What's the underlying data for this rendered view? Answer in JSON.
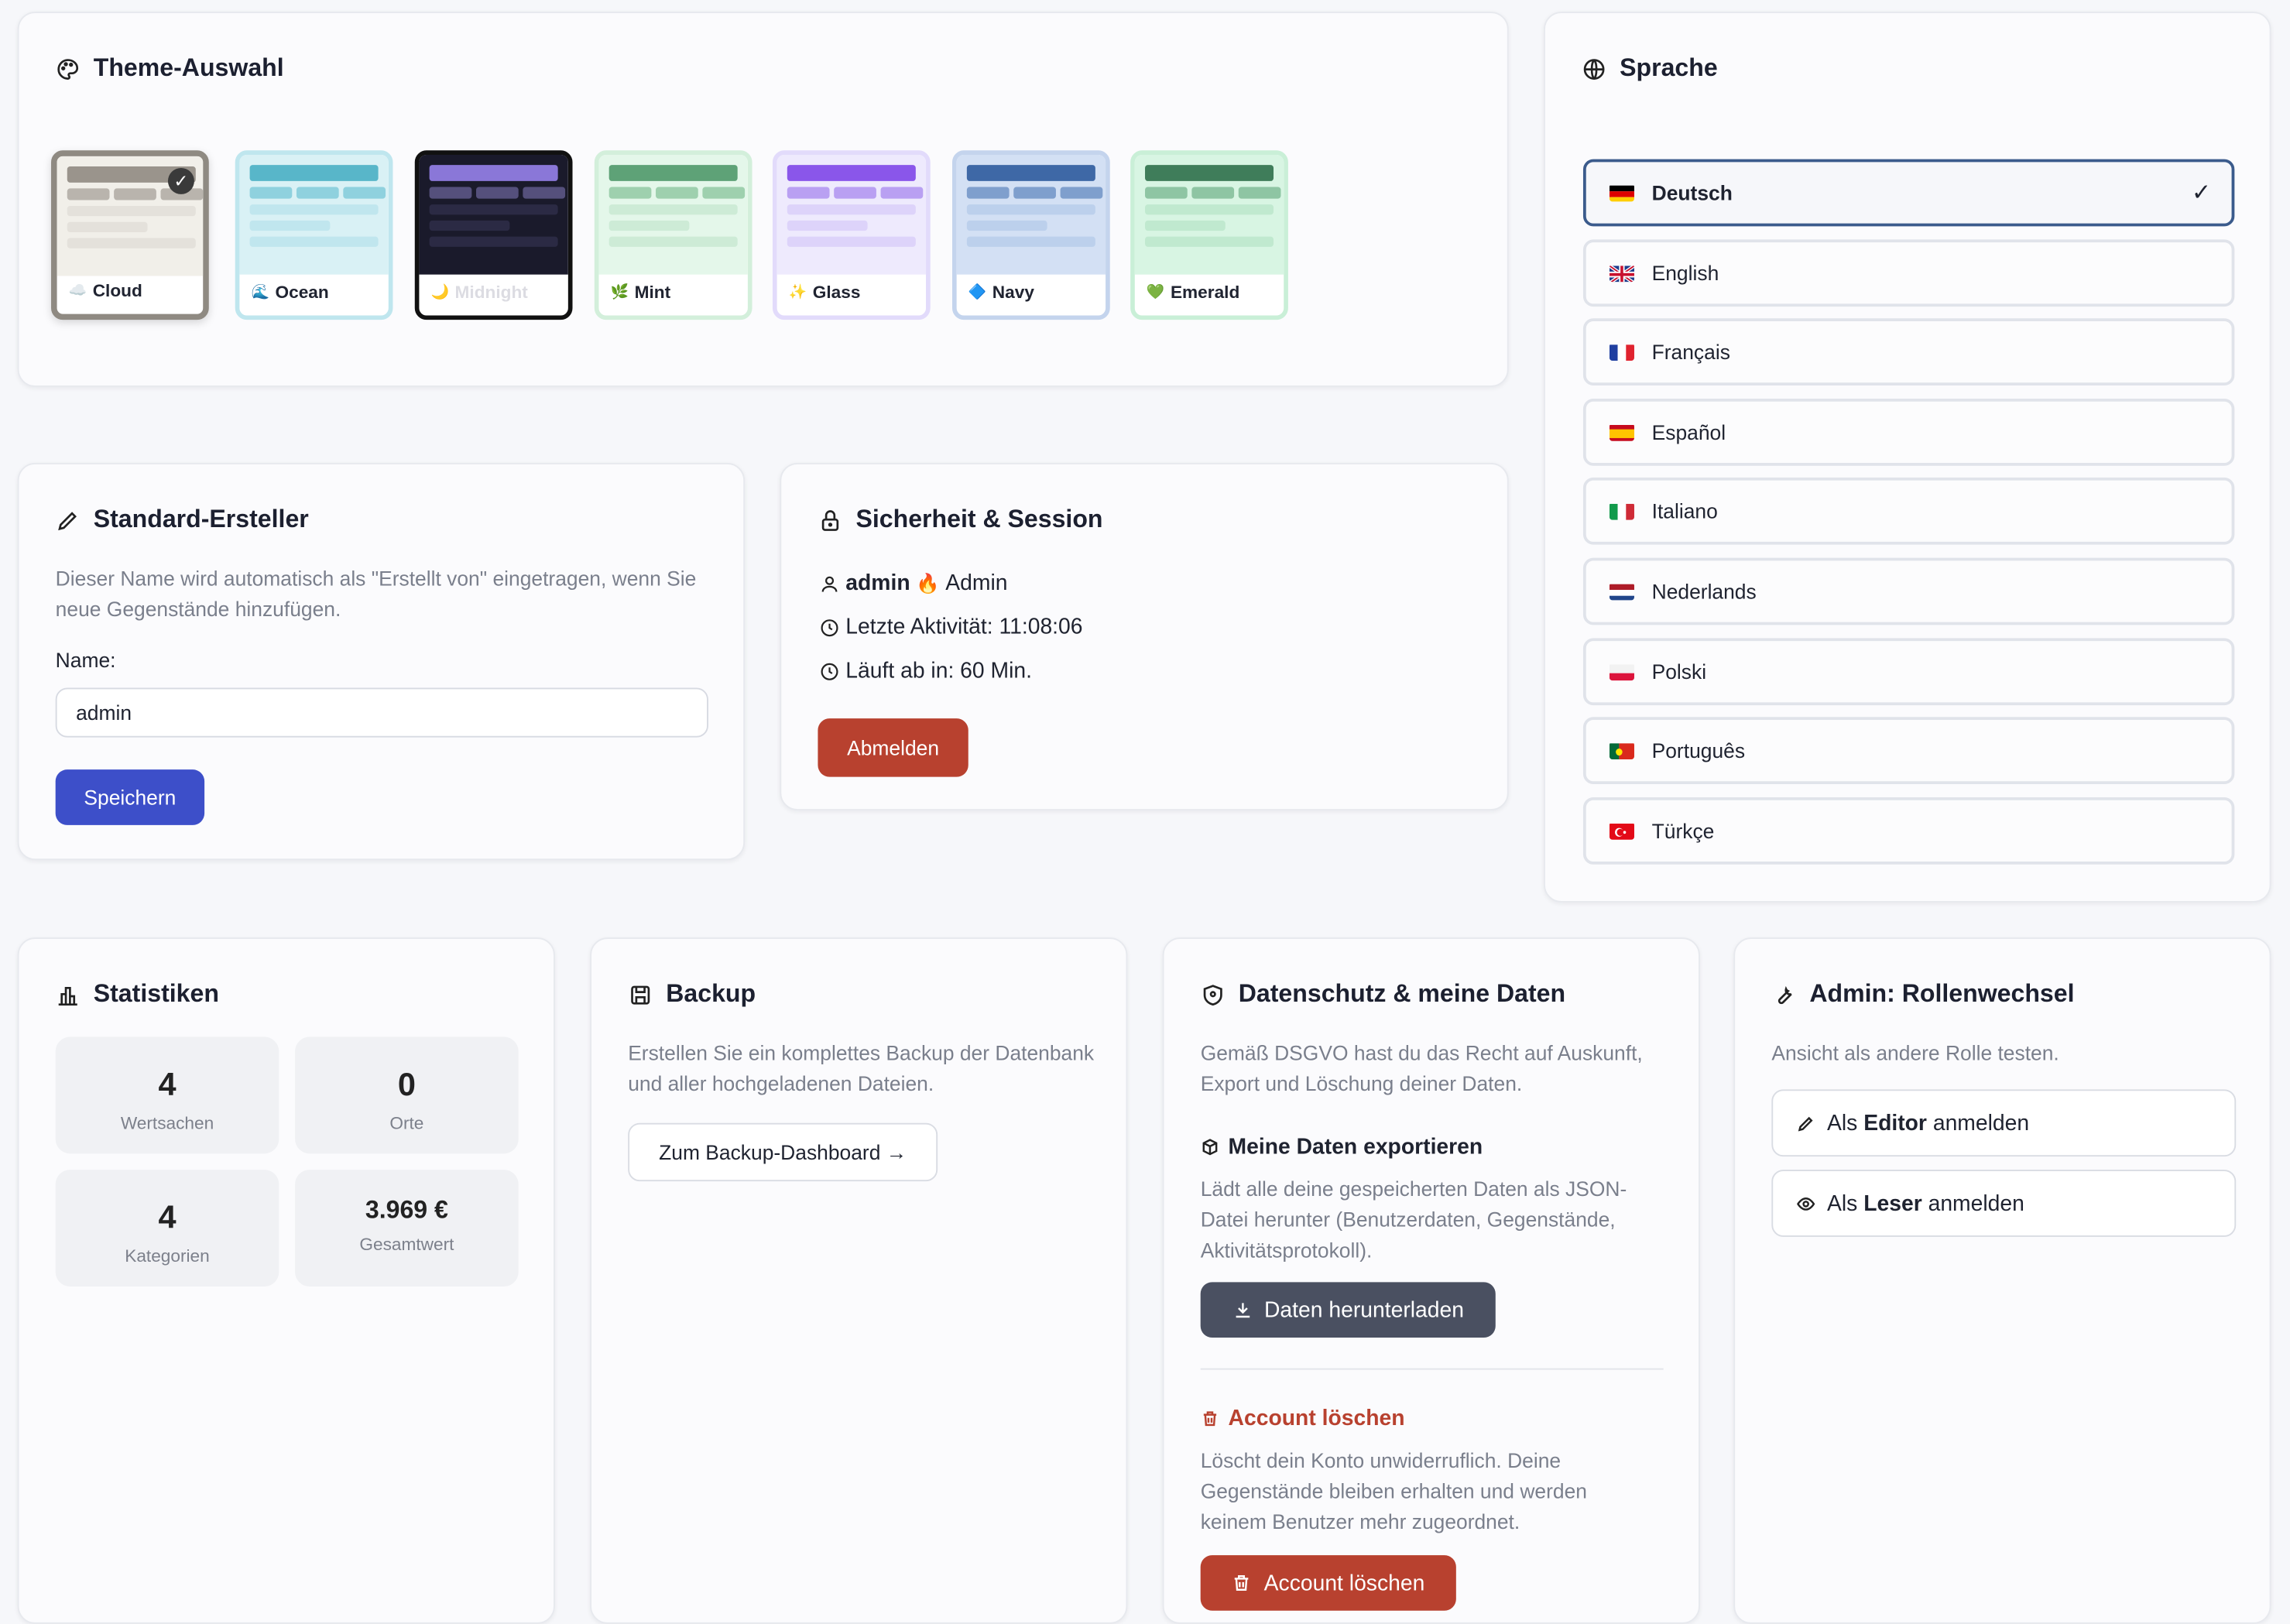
{
  "theme": {
    "title": "Theme-Auswahl",
    "options": [
      {
        "label": "Cloud",
        "emoji": "☁️",
        "selected": true,
        "colors": {
          "bg": "#f1efe9",
          "bar1": "#9a948c",
          "bar2": "#b9b4ad",
          "line": "#e4e1db",
          "border": "#8f8a82",
          "text": "#202431"
        }
      },
      {
        "label": "Ocean",
        "emoji": "🌊",
        "selected": false,
        "colors": {
          "bg": "#d9f1f5",
          "bar1": "#58b6c9",
          "bar2": "#8fd1de",
          "line": "#c0e6ee",
          "border": "#bfe6ee",
          "text": "#202431"
        }
      },
      {
        "label": "Midnight",
        "emoji": "🌙",
        "selected": false,
        "colors": {
          "bg": "#1a1a2b",
          "bar1": "#8a77d8",
          "bar2": "#55507c",
          "line": "#2b2a44",
          "border": "#111",
          "text": "#dcdce2"
        }
      },
      {
        "label": "Mint",
        "emoji": "🌿",
        "selected": false,
        "colors": {
          "bg": "#e4f7ea",
          "bar1": "#5ea277",
          "bar2": "#9ed0ae",
          "line": "#cdebd6",
          "border": "#d3efdb",
          "text": "#202431"
        }
      },
      {
        "label": "Glass",
        "emoji": "✨",
        "selected": false,
        "colors": {
          "bg": "#eeeafd",
          "bar1": "#8a56ea",
          "bar2": "#b9a0f2",
          "line": "#ddd3fa",
          "border": "#e2dbfb",
          "text": "#202431"
        }
      },
      {
        "label": "Navy",
        "emoji": "🔷",
        "selected": false,
        "colors": {
          "bg": "#d3e0f4",
          "bar1": "#3e68a6",
          "bar2": "#7f9fcd",
          "line": "#bcd0ec",
          "border": "#c4d4ed",
          "text": "#202431"
        }
      },
      {
        "label": "Emerald",
        "emoji": "💚",
        "selected": false,
        "colors": {
          "bg": "#d8f5e3",
          "bar1": "#3f7d5a",
          "bar2": "#8ec5a3",
          "line": "#c0e9cf",
          "border": "#c9efd7",
          "text": "#202431"
        }
      }
    ]
  },
  "language": {
    "title": "Sprache",
    "options": [
      {
        "label": "Deutsch",
        "flag": "de",
        "selected": true
      },
      {
        "label": "English",
        "flag": "gb",
        "selected": false
      },
      {
        "label": "Français",
        "flag": "fr",
        "selected": false
      },
      {
        "label": "Español",
        "flag": "es",
        "selected": false
      },
      {
        "label": "Italiano",
        "flag": "it",
        "selected": false
      },
      {
        "label": "Nederlands",
        "flag": "nl",
        "selected": false
      },
      {
        "label": "Polski",
        "flag": "pl",
        "selected": false
      },
      {
        "label": "Português",
        "flag": "pt",
        "selected": false
      },
      {
        "label": "Türkçe",
        "flag": "tr",
        "selected": false
      }
    ],
    "check": "✓"
  },
  "creator": {
    "title": "Standard-Ersteller",
    "description": "Dieser Name wird automatisch als \"Erstellt von\" eingetragen, wenn Sie neue Gegenstände hinzufügen.",
    "name_label": "Name:",
    "name_value": "admin",
    "save_label": "Speichern"
  },
  "session": {
    "title": "Sicherheit & Session",
    "user": "admin",
    "role_emoji": "🔥",
    "role": "Admin",
    "last_activity": "Letzte Aktivität: 11:08:06",
    "expires": "Läuft ab in: 60 Min.",
    "logout_label": "Abmelden"
  },
  "stats": {
    "title": "Statistiken",
    "items": [
      {
        "value": "4",
        "label": "Wertsachen"
      },
      {
        "value": "0",
        "label": "Orte"
      },
      {
        "value": "4",
        "label": "Kategorien"
      },
      {
        "value": "3.969 €",
        "label": "Gesamtwert"
      }
    ]
  },
  "backup": {
    "title": "Backup",
    "description": "Erstellen Sie ein komplettes Backup der Datenbank und aller hochgeladenen Dateien.",
    "button_label": "Zum Backup-Dashboard →"
  },
  "privacy": {
    "title": "Datenschutz & meine Daten",
    "intro": "Gemäß DSGVO hast du das Recht auf Auskunft, Export und Löschung deiner Daten.",
    "export_title": "Meine Daten exportieren",
    "export_desc": "Lädt alle deine gespeicherten Daten als JSON-Datei herunter (Benutzerdaten, Gegenstände, Aktivitätsprotokoll).",
    "download_label": "Daten herunterladen",
    "delete_title": "Account löschen",
    "delete_desc": "Löscht dein Konto unwiderruflich. Deine Gegenstände bleiben erhalten und werden keinem Benutzer mehr zugeordnet.",
    "delete_label": "Account löschen"
  },
  "role": {
    "title": "Admin: Rollenwechsel",
    "description": "Ansicht als andere Rolle testen.",
    "editor_pre": "Als ",
    "editor_bold": "Editor",
    "editor_post": " anmelden",
    "reader_pre": "Als ",
    "reader_bold": "Leser",
    "reader_post": " anmelden"
  },
  "colors": {
    "primary": "#3d4fc9",
    "danger": "#b8412f",
    "slate": "#4a5061",
    "active_border": "#3b5b8c"
  }
}
